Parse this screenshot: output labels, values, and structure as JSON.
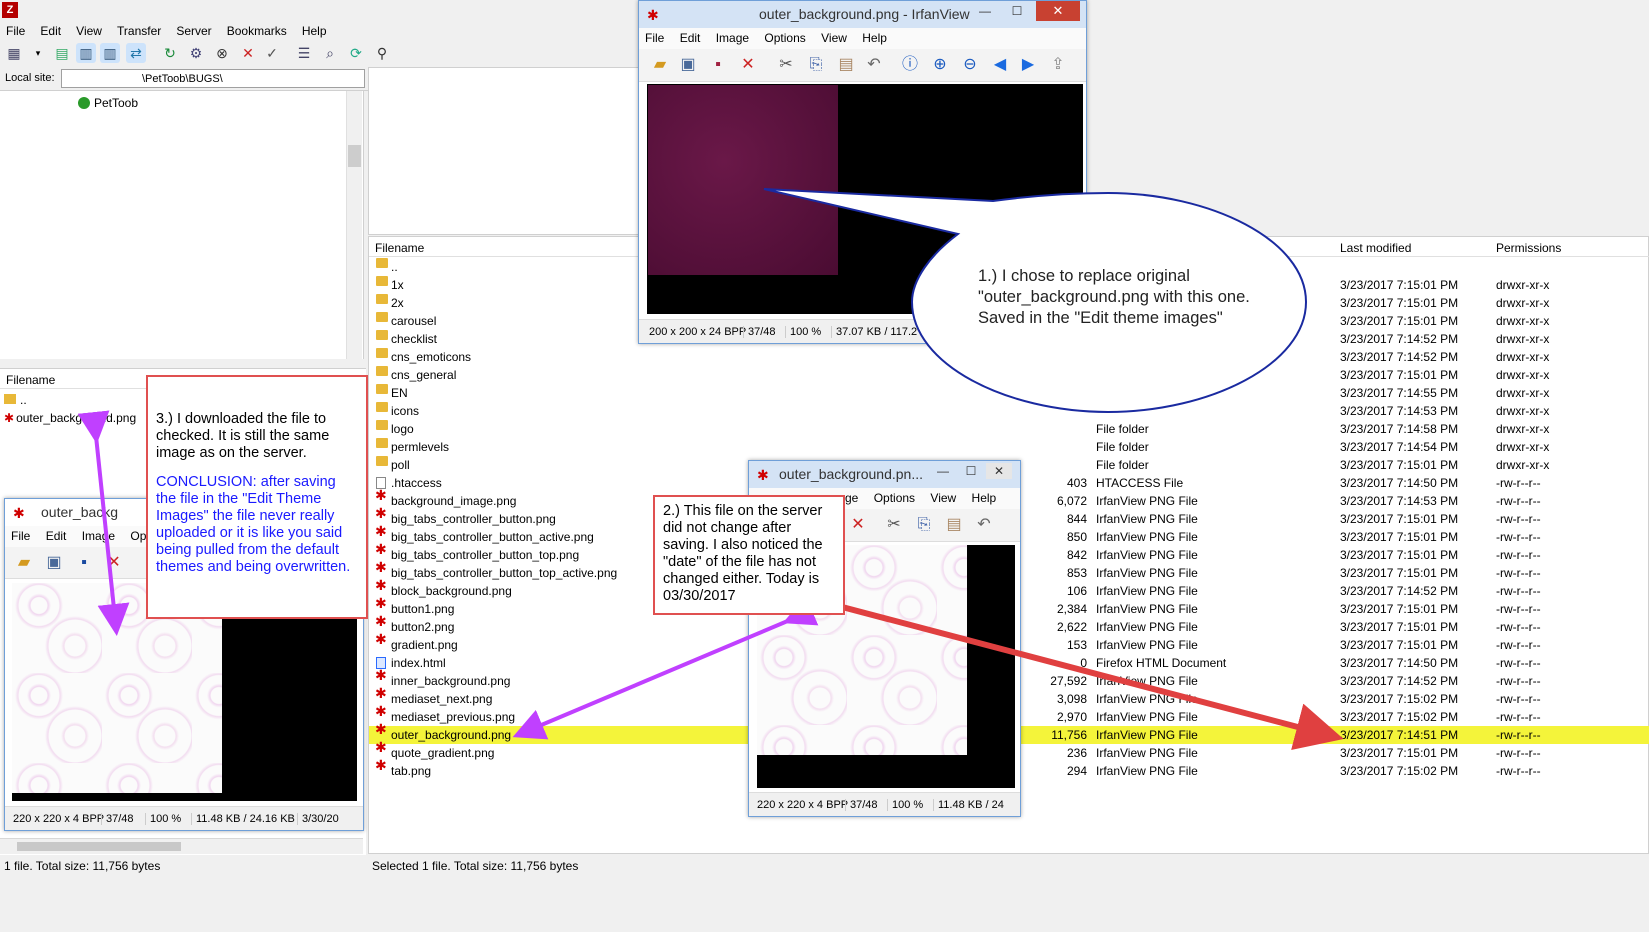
{
  "app": {
    "menu": [
      "File",
      "Edit",
      "View",
      "Transfer",
      "Server",
      "Bookmarks",
      "Help"
    ],
    "local_site_label": "Local site:",
    "local_site_path": "\\PetToob\\BUGS\\",
    "tree_item": "PetToob"
  },
  "local": {
    "header": "Filename",
    "rows": [
      "..",
      "outer_background.png"
    ],
    "status": "1 file. Total size: 11,756 bytes"
  },
  "remote": {
    "headers": {
      "name": "Filename",
      "modified": "Last modified",
      "perms": "Permissions"
    },
    "rows": [
      {
        "name": "..",
        "icon": "folder",
        "size": "",
        "type": "",
        "date": "",
        "perm": ""
      },
      {
        "name": "1x",
        "icon": "folder",
        "size": "",
        "type": "",
        "date": "3/23/2017 7:15:01 PM",
        "perm": "drwxr-xr-x"
      },
      {
        "name": "2x",
        "icon": "folder",
        "size": "",
        "type": "",
        "date": "3/23/2017 7:15:01 PM",
        "perm": "drwxr-xr-x"
      },
      {
        "name": "carousel",
        "icon": "folder",
        "size": "",
        "type": "",
        "date": "3/23/2017 7:15:01 PM",
        "perm": "drwxr-xr-x"
      },
      {
        "name": "checklist",
        "icon": "folder",
        "size": "",
        "type": "",
        "date": "3/23/2017 7:14:52 PM",
        "perm": "drwxr-xr-x"
      },
      {
        "name": "cns_emoticons",
        "icon": "folder",
        "size": "",
        "type": "",
        "date": "3/23/2017 7:14:52 PM",
        "perm": "drwxr-xr-x"
      },
      {
        "name": "cns_general",
        "icon": "folder",
        "size": "",
        "type": "",
        "date": "3/23/2017 7:15:01 PM",
        "perm": "drwxr-xr-x"
      },
      {
        "name": "EN",
        "icon": "folder",
        "size": "",
        "type": "",
        "date": "3/23/2017 7:14:55 PM",
        "perm": "drwxr-xr-x"
      },
      {
        "name": "icons",
        "icon": "folder",
        "size": "",
        "type": "",
        "date": "3/23/2017 7:14:53 PM",
        "perm": "drwxr-xr-x"
      },
      {
        "name": "logo",
        "icon": "folder",
        "size": "",
        "type": "File folder",
        "date": "3/23/2017 7:14:58 PM",
        "perm": "drwxr-xr-x"
      },
      {
        "name": "permlevels",
        "icon": "folder",
        "size": "",
        "type": "File folder",
        "date": "3/23/2017 7:14:54 PM",
        "perm": "drwxr-xr-x"
      },
      {
        "name": "poll",
        "icon": "folder",
        "size": "",
        "type": "File folder",
        "date": "3/23/2017 7:15:01 PM",
        "perm": "drwxr-xr-x"
      },
      {
        "name": ".htaccess",
        "icon": "txt",
        "size": "403",
        "type": "HTACCESS File",
        "date": "3/23/2017 7:14:50 PM",
        "perm": "-rw-r--r--"
      },
      {
        "name": "background_image.png",
        "icon": "png",
        "size": "6,072",
        "type": "IrfanView PNG File",
        "date": "3/23/2017 7:14:53 PM",
        "perm": "-rw-r--r--"
      },
      {
        "name": "big_tabs_controller_button.png",
        "icon": "png",
        "size": "844",
        "type": "IrfanView PNG File",
        "date": "3/23/2017 7:15:01 PM",
        "perm": "-rw-r--r--"
      },
      {
        "name": "big_tabs_controller_button_active.png",
        "icon": "png",
        "size": "850",
        "type": "IrfanView PNG File",
        "date": "3/23/2017 7:15:01 PM",
        "perm": "-rw-r--r--"
      },
      {
        "name": "big_tabs_controller_button_top.png",
        "icon": "png",
        "size": "842",
        "type": "IrfanView PNG File",
        "date": "3/23/2017 7:15:01 PM",
        "perm": "-rw-r--r--"
      },
      {
        "name": "big_tabs_controller_button_top_active.png",
        "icon": "png",
        "size": "853",
        "type": "IrfanView PNG File",
        "date": "3/23/2017 7:15:01 PM",
        "perm": "-rw-r--r--"
      },
      {
        "name": "block_background.png",
        "icon": "png",
        "size": "106",
        "type": "IrfanView PNG File",
        "date": "3/23/2017 7:14:52 PM",
        "perm": "-rw-r--r--"
      },
      {
        "name": "button1.png",
        "icon": "png",
        "size": "2,384",
        "type": "IrfanView PNG File",
        "date": "3/23/2017 7:15:01 PM",
        "perm": "-rw-r--r--"
      },
      {
        "name": "button2.png",
        "icon": "png",
        "size": "2,622",
        "type": "IrfanView PNG File",
        "date": "3/23/2017 7:15:01 PM",
        "perm": "-rw-r--r--"
      },
      {
        "name": "gradient.png",
        "icon": "png",
        "size": "153",
        "type": "IrfanView PNG File",
        "date": "3/23/2017 7:15:01 PM",
        "perm": "-rw-r--r--"
      },
      {
        "name": "index.html",
        "icon": "html",
        "size": "0",
        "type": "Firefox HTML Document",
        "date": "3/23/2017 7:14:50 PM",
        "perm": "-rw-r--r--"
      },
      {
        "name": "inner_background.png",
        "icon": "png",
        "size": "27,592",
        "type": "IrfanView PNG File",
        "date": "3/23/2017 7:14:52 PM",
        "perm": "-rw-r--r--"
      },
      {
        "name": "mediaset_next.png",
        "icon": "png",
        "size": "3,098",
        "type": "IrfanView PNG File",
        "date": "3/23/2017 7:15:02 PM",
        "perm": "-rw-r--r--"
      },
      {
        "name": "mediaset_previous.png",
        "icon": "png",
        "size": "2,970",
        "type": "IrfanView PNG File",
        "date": "3/23/2017 7:15:02 PM",
        "perm": "-rw-r--r--"
      },
      {
        "name": "outer_background.png",
        "icon": "png",
        "size": "11,756",
        "type": "IrfanView PNG File",
        "date": "3/23/2017 7:14:51 PM",
        "perm": "-rw-r--r--",
        "selected": true
      },
      {
        "name": "quote_gradient.png",
        "icon": "png",
        "size": "236",
        "type": "IrfanView PNG File",
        "date": "3/23/2017 7:15:01 PM",
        "perm": "-rw-r--r--"
      },
      {
        "name": "tab.png",
        "icon": "png",
        "size": "294",
        "type": "IrfanView PNG File",
        "date": "3/23/2017 7:15:02 PM",
        "perm": "-rw-r--r--"
      }
    ],
    "status": "Selected 1 file. Total size: 11,756 bytes"
  },
  "irfan_top": {
    "title": "outer_background.png - IrfanView",
    "menu": [
      "File",
      "Edit",
      "Image",
      "Options",
      "View",
      "Help"
    ],
    "status": [
      "200 x 200 x 24 BPP",
      "37/48",
      "100 %",
      "37.07 KB / 117.2"
    ]
  },
  "irfan_mid": {
    "title": "outer_background.pn...",
    "menu": [
      "ge",
      "Options",
      "View",
      "Help"
    ],
    "status": [
      "220 x 220 x 4 BPP",
      "37/48",
      "100 %",
      "11.48 KB / 24"
    ]
  },
  "irfan_left": {
    "title": "outer_backg",
    "menu": [
      "File",
      "Edit",
      "Image",
      "Optio"
    ],
    "status": [
      "220 x 220 x 4 BPP",
      "37/48",
      "100 %",
      "11.48 KB / 24.16 KB",
      "3/30/20"
    ]
  },
  "annotations": {
    "bubble": "1.)  I chose to replace original \"outer_background.png with this one. Saved in the \"Edit theme images\"",
    "note2": "2.)  This file on the server did not change after saving. I also noticed the \"date\" of the file has not changed either. Today is 03/30/2017",
    "note3_a": "3.)  I downloaded the file to checked. It is still the same image as on the server.",
    "note3_b": "CONCLUSION:  after saving the file in the \"Edit Theme Images\" the file never really uploaded or it is like you said being pulled from the default themes and being overwritten."
  },
  "colors": {
    "highlight": "#f4f43a",
    "arrow_red": "#e04040",
    "arrow_purple": "#c040ff",
    "note_border": "#e05050",
    "conclusion_blue": "#1a1aff"
  }
}
